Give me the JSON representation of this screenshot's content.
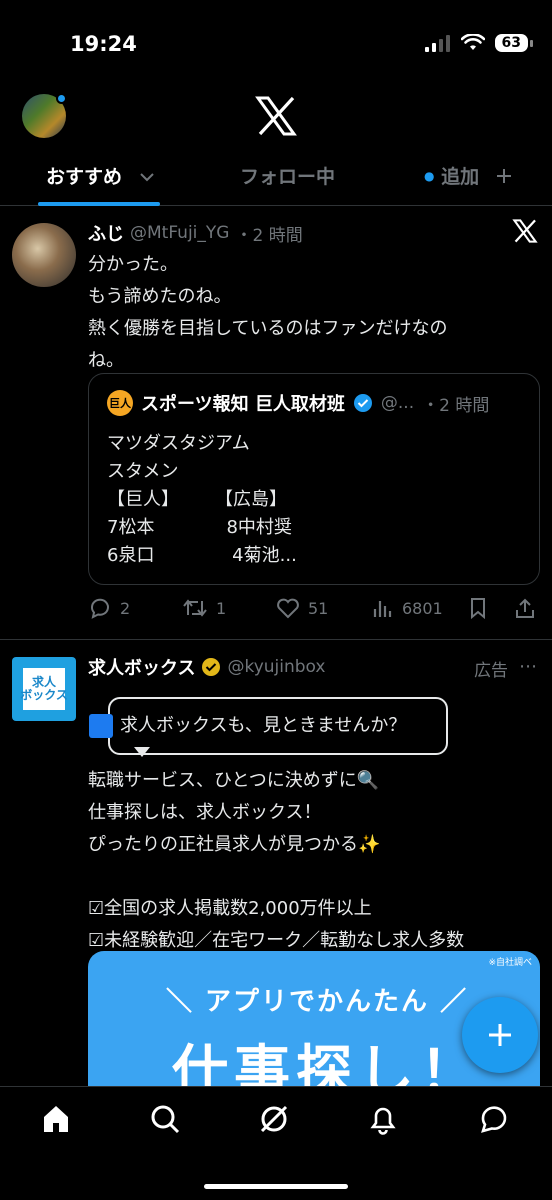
{
  "status_bar": {
    "time": "19:24",
    "battery": "63"
  },
  "header": {
    "logo": "x-logo"
  },
  "tabs": [
    {
      "label": "おすすめ",
      "active": true
    },
    {
      "label": "フォロー中",
      "active": false
    },
    {
      "label": "追加",
      "active": false
    }
  ],
  "tweets": [
    {
      "display_name": "ふじ",
      "handle": "@MtFuji_YG",
      "time": "・2 時間",
      "text": "分かった。\nもう諦めたのね。\n熱く優勝を目指しているのはファンだけなの\nね。",
      "quote": {
        "avatar_text": "巨人",
        "display_name": "スポーツ報知 巨人取材班",
        "handle": "@...",
        "time": "・2 時間",
        "text": "マツダスタジアム\nスタメン\n【巨人】　　　【広島】\n7松本　　　　8中村奨\n6泉口　　　　 4菊池..."
      },
      "stats": {
        "replies": "2",
        "retweets": "1",
        "likes": "51",
        "views": "6801"
      }
    },
    {
      "display_name": "求人ボックス",
      "handle": "@kyujinbox",
      "ad_label": "広告",
      "avatar_text": "求人\nボックス",
      "bubble_text": "求人ボックスも、見ときませんか？",
      "text": "転職サービス、ひとつに決めずに🔍\n仕事探しは、求人ボックス！\nぴったりの正社員求人が見つかる✨\n\n☑全国の求人掲載数2,000万件以上\n☑未経験歓迎／在宅ワーク／転勤なし求人多数",
      "image": {
        "note": "※自社調べ",
        "subtitle": "＼ アプリでかんたん ／",
        "title": "仕事探し！"
      }
    }
  ],
  "colors": {
    "accent": "#1d9bf0",
    "muted": "#71767b",
    "divider": "#2f3336"
  },
  "bottom_nav": [
    "home-icon",
    "search-icon",
    "grok-icon",
    "notifications-icon",
    "messages-icon"
  ]
}
